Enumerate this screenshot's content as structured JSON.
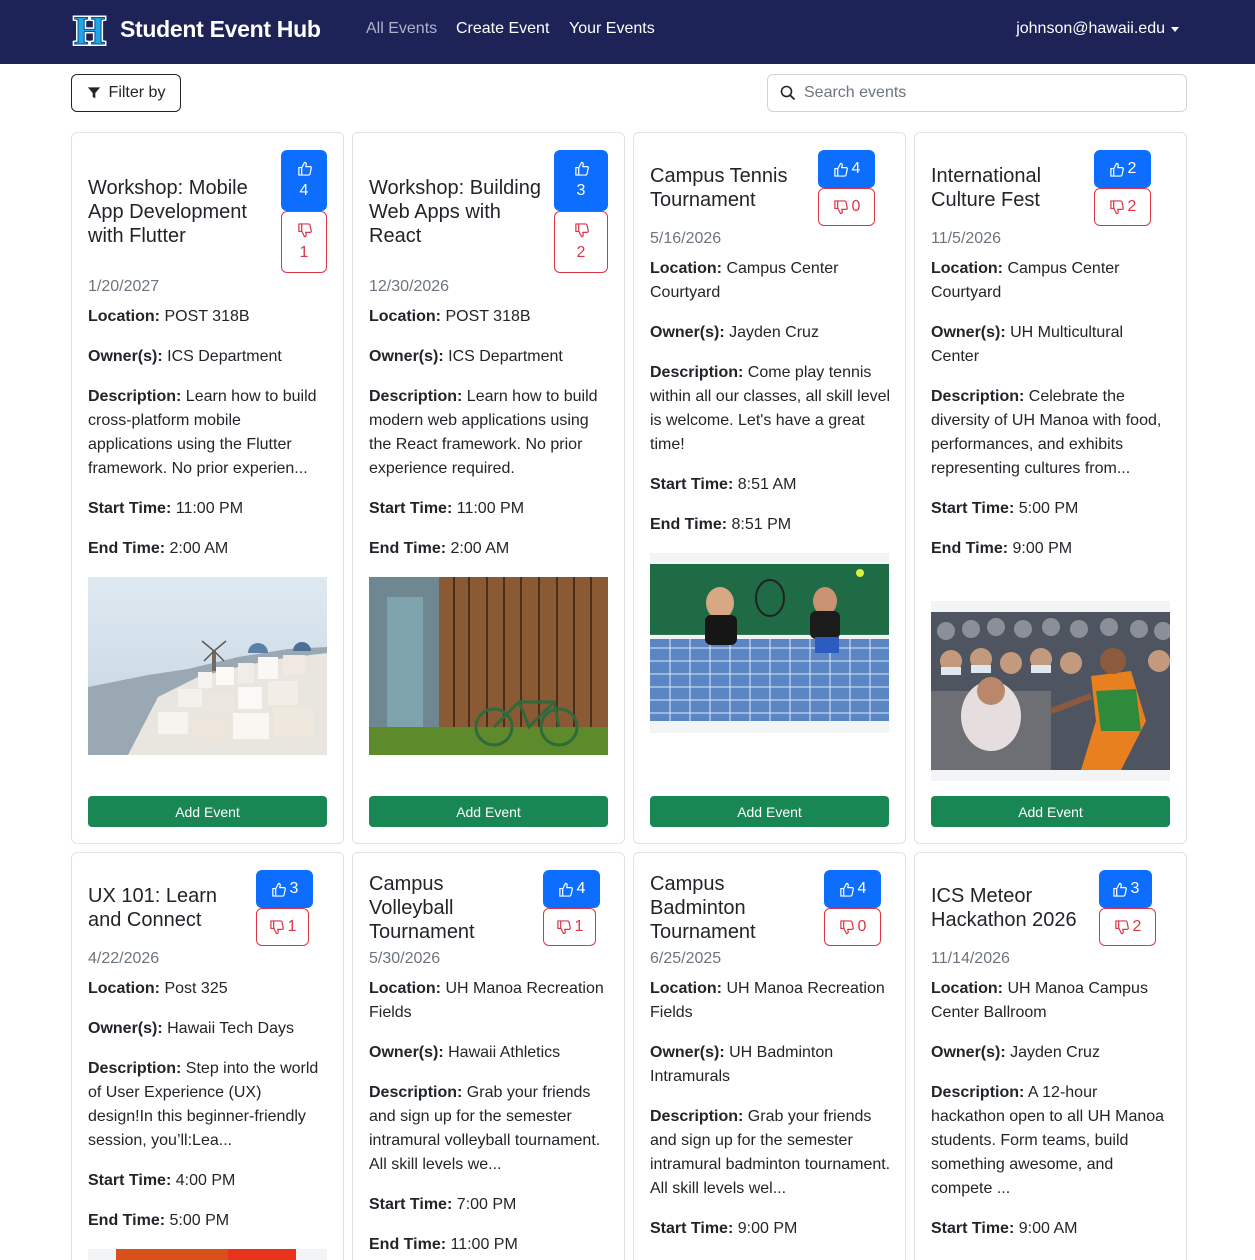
{
  "brand": {
    "name": "Student Event Hub",
    "logo_letter": "H"
  },
  "nav": {
    "all_events": "All Events",
    "create_event": "Create Event",
    "your_events": "Your Events",
    "user_email": "johnson@hawaii.edu"
  },
  "toolbar": {
    "filter_label": "Filter by",
    "search_placeholder": "Search events"
  },
  "labels": {
    "location": "Location:",
    "owners": "Owner(s):",
    "description": "Description:",
    "start_time": "Start Time:",
    "end_time": "End Time:",
    "add_event": "Add Event"
  },
  "events": [
    {
      "title": "Workshop: Mobile App Development with Flutter",
      "likes": "4",
      "dislikes": "1",
      "date": "1/20/2027",
      "location": "POST 318B",
      "owners": "ICS Department",
      "description": "Learn how to build cross-platform mobile applications using the Flutter framework. No prior experien...",
      "start_time": "11:00 PM",
      "end_time": "2:00 AM",
      "image": "coastal-village-photo"
    },
    {
      "title": "Workshop: Building Web Apps with React",
      "likes": "3",
      "dislikes": "2",
      "date": "12/30/2026",
      "location": "POST 318B",
      "owners": "ICS Department",
      "description": "Learn how to build modern web applications using the React framework. No prior experience required.",
      "start_time": "11:00 PM",
      "end_time": "2:00 AM",
      "image": "wooden-shed-bicycle-photo"
    },
    {
      "title": "Campus Tennis Tournament",
      "likes": "4",
      "dislikes": "0",
      "date": "5/16/2026",
      "location": "Campus Center Courtyard",
      "owners": "Jayden Cruz",
      "description": "Come play tennis within all our classes, all skill level is welcome. Let's have a great time!",
      "start_time": "8:51 AM",
      "end_time": "8:51 PM",
      "image": "tennis-players-photo"
    },
    {
      "title": "International Culture Fest",
      "likes": "2",
      "dislikes": "2",
      "date": "11/5/2026",
      "location": "Campus Center Courtyard",
      "owners": "UH Multicultural Center",
      "description": "Celebrate the diversity of UH Manoa with food, performances, and exhibits representing cultures from...",
      "start_time": "5:00 PM",
      "end_time": "9:00 PM",
      "image": "cultural-dance-photo"
    },
    {
      "title": "UX 101: Learn and Connect",
      "likes": "3",
      "dislikes": "1",
      "date": "4/22/2026",
      "location": "Post 325",
      "owners": "Hawaii Tech Days",
      "description": "Step into the world of User Experience (UX) design!In this beginner-friendly session, you’ll:Lea...",
      "start_time": "4:00 PM",
      "end_time": "5:00 PM",
      "image": "ux-event-photo"
    },
    {
      "title": "Campus Volleyball Tournament",
      "likes": "4",
      "dislikes": "1",
      "date": "5/30/2026",
      "location": "UH Manoa Recreation Fields",
      "owners": "Hawaii Athletics",
      "description": "Grab your friends and sign up for the semester intramural volleyball tournament. All skill levels we...",
      "start_time": "7:00 PM",
      "end_time": "11:00 PM",
      "image": ""
    },
    {
      "title": "Campus Badminton Tournament",
      "likes": "4",
      "dislikes": "0",
      "date": "6/25/2025",
      "location": "UH Manoa Recreation Fields",
      "owners": "UH Badminton Intramurals",
      "description": "Grab your friends and sign up for the semester intramural badminton tournament. All skill levels wel...",
      "start_time": "9:00 PM",
      "end_time": "",
      "image": ""
    },
    {
      "title": "ICS Meteor Hackathon 2026",
      "likes": "3",
      "dislikes": "2",
      "date": "11/14/2026",
      "location": "UH Manoa Campus Center Ballroom",
      "owners": "Jayden Cruz",
      "description": "A 12-hour hackathon open to all UH Manoa students. Form teams, build something awesome, and compete ...",
      "start_time": "9:00 AM",
      "end_time": "",
      "image": ""
    }
  ],
  "colors": {
    "navbar": "#1e2357",
    "like": "#0d6efd",
    "dislike": "#dc3545",
    "add_event": "#198754"
  },
  "icons": {
    "like": "thumbs-up-icon",
    "dislike": "thumbs-down-icon",
    "filter": "funnel-icon",
    "search": "search-icon"
  }
}
